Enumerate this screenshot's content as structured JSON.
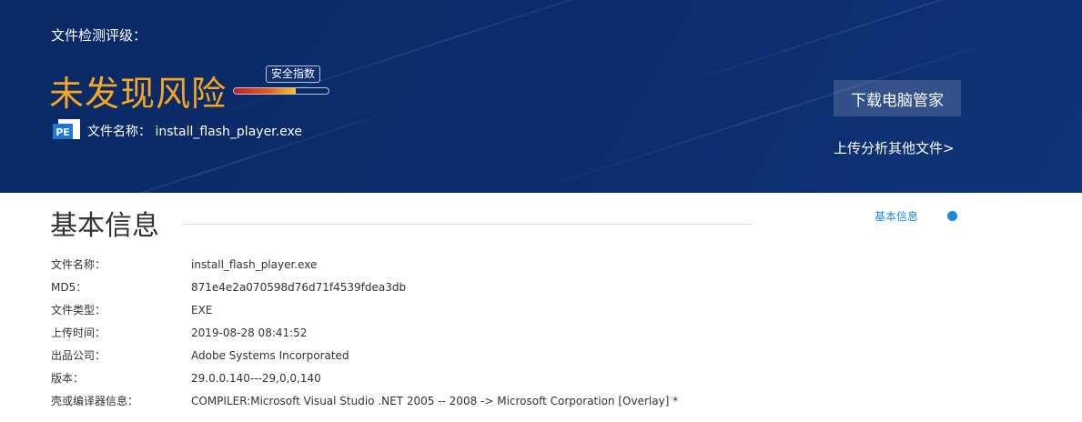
{
  "banner": {
    "rating_heading": "文件检测评级：",
    "verdict": "未发现风险",
    "safety_index_label": "安全指数",
    "safety_index_level": 0.65,
    "file_label": "文件名称：",
    "file_name": "install_flash_player.exe",
    "file_icon": "pe-file-icon",
    "file_icon_text": "PE",
    "download_button": "下载电脑管家",
    "upload_link": "上传分析其他文件>"
  },
  "basic_info": {
    "title": "基本信息",
    "rows": [
      {
        "label": "文件名称：",
        "value": "install_flash_player.exe"
      },
      {
        "label": "MD5：",
        "value": "871e4e2a070598d76d71f4539fdea3db"
      },
      {
        "label": "文件类型：",
        "value": "EXE"
      },
      {
        "label": "上传时间：",
        "value": "2019-08-28 08:41:52"
      },
      {
        "label": "出品公司：",
        "value": "Adobe Systems Incorporated"
      },
      {
        "label": "版本：",
        "value": "29.0.0.140---29,0,0,140"
      },
      {
        "label": "壳或编译器信息：",
        "value": "COMPILER:Microsoft Visual Studio .NET 2005 -- 2008 -> Microsoft Corporation [Overlay] *"
      }
    ]
  },
  "side_nav": {
    "items": [
      {
        "label": "基本信息",
        "active": true
      }
    ],
    "accent_color": "#1a8bdc"
  },
  "colors": {
    "banner_bg": "#0b2b6a",
    "verdict": "#f5a623"
  }
}
